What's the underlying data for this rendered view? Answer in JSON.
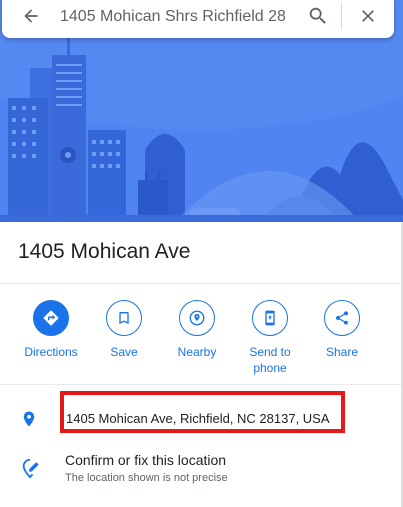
{
  "search": {
    "query": "1405 Mohican Shrs Richfield 28"
  },
  "icons": {
    "back": "arrow-back-icon",
    "search": "search-icon",
    "close": "close-icon",
    "directions": "directions-icon",
    "save": "bookmark-icon",
    "nearby": "nearby-icon",
    "send": "send-to-phone-icon",
    "share": "share-icon",
    "location": "location-pin-icon",
    "confirm": "edit-location-icon"
  },
  "place": {
    "title": "1405 Mohican Ave",
    "address": "1405 Mohican Ave, Richfield, NC 28137, USA"
  },
  "actions": [
    {
      "label": "Directions"
    },
    {
      "label": "Save"
    },
    {
      "label": "Nearby"
    },
    {
      "label": "Send to phone"
    },
    {
      "label": "Share"
    }
  ],
  "confirm": {
    "title": "Confirm or fix this location",
    "subtitle": "The location shown is not precise"
  },
  "colors": {
    "accent": "#1a73e8",
    "hero_bg": "#4d82f0",
    "highlight_box": "#e8171a"
  }
}
